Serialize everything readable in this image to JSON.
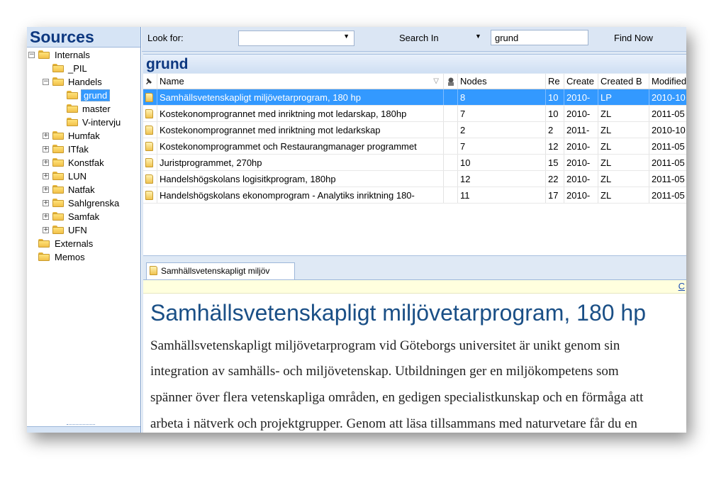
{
  "sidebar": {
    "title": "Sources",
    "tree": [
      {
        "label": "Internals"
      },
      {
        "label": "_PIL"
      },
      {
        "label": "Handels"
      },
      {
        "label": "grund"
      },
      {
        "label": "master"
      },
      {
        "label": "V-intervju"
      },
      {
        "label": "Humfak"
      },
      {
        "label": "ITfak"
      },
      {
        "label": "Konstfak"
      },
      {
        "label": "LUN"
      },
      {
        "label": "Natfak"
      },
      {
        "label": "Sahlgrenska"
      },
      {
        "label": "Samfak"
      },
      {
        "label": "UFN"
      },
      {
        "label": "Externals"
      },
      {
        "label": "Memos"
      }
    ]
  },
  "search": {
    "look_for_label": "Look for:",
    "look_for_value": "",
    "search_in_label": "Search In",
    "query": "grund",
    "find_now_label": "Find Now"
  },
  "folder_title": "grund",
  "list": {
    "columns": [
      "Name",
      "Nodes",
      "Re",
      "Create",
      "Created B",
      "Modified"
    ],
    "rows": [
      {
        "name": "Samhällsvetenskapligt miljövetarprogram, 180 hp",
        "nodes": "8",
        "refs": "10",
        "created": "2010-",
        "created_by": "LP",
        "modified": "2010-10"
      },
      {
        "name": "Kostekonomprogrannet med inriktning mot ledarskap, 180hp",
        "nodes": "7",
        "refs": "10",
        "created": "2010-",
        "created_by": "ZL",
        "modified": "2011-05"
      },
      {
        "name": "Kostekonomprogrannet med inriktning mot ledarkskap",
        "nodes": "2",
        "refs": "2",
        "created": "2011-",
        "created_by": "ZL",
        "modified": "2010-10"
      },
      {
        "name": "Kostekonomprogrammet och Restaurangmanager programmet",
        "nodes": "7",
        "refs": "12",
        "created": "2010-",
        "created_by": "ZL",
        "modified": "2011-05"
      },
      {
        "name": "Juristprogrammet, 270hp",
        "nodes": "10",
        "refs": "15",
        "created": "2010-",
        "created_by": "ZL",
        "modified": "2011-05"
      },
      {
        "name": "Handelshögskolans logisitkprogram, 180hp",
        "nodes": "12",
        "refs": "22",
        "created": "2010-",
        "created_by": "ZL",
        "modified": "2011-05"
      },
      {
        "name": "Handelshögskolans ekonomprogram - Analytiks inriktning 180-",
        "nodes": "11",
        "refs": "17",
        "created": "2010-",
        "created_by": "ZL",
        "modified": "2011-05"
      }
    ]
  },
  "document": {
    "tab_label": "Samhällsvetenskapligt miljöv",
    "link_text": "C",
    "title": "Samhällsvetenskapligt miljövetarprogram, 180 hp",
    "lines": [
      "Samhällsvetenskapligt miljövetarprogram vid Göteborgs universitet är unikt genom sin",
      "integration av samhälls- och miljövetenskap. Utbildningen ger en miljökompetens som",
      "spänner över flera vetenskapliga områden, en gedigen specialistkunskap och en förmåga att",
      "arbeta i nätverk och projektgrupper. Genom att läsa tillsammans med naturvetare får du en"
    ]
  }
}
